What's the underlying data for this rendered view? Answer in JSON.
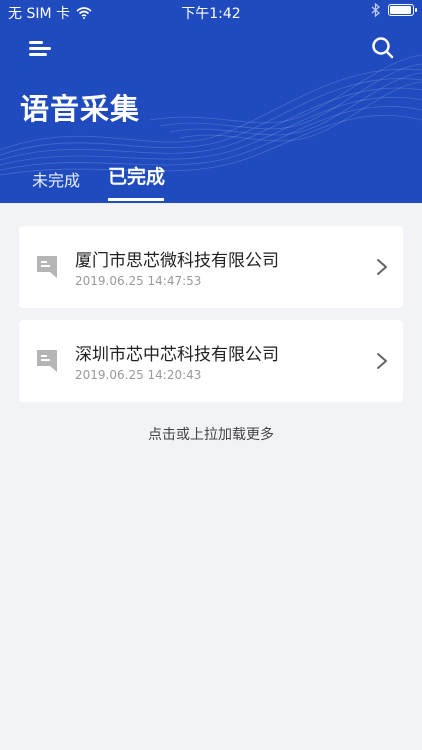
{
  "status_bar": {
    "carrier": "无 SIM 卡",
    "time": "下午1:42",
    "battery_level": 0.95
  },
  "header": {
    "title": "语音采集",
    "tabs": [
      {
        "label": "未完成",
        "active": false
      },
      {
        "label": "已完成",
        "active": true
      }
    ],
    "background_color": "#1f4bbf"
  },
  "records": [
    {
      "company": "厦门市思芯微科技有限公司",
      "datetime": "2019.06.25 14:47:53"
    },
    {
      "company": "深圳市芯中芯科技有限公司",
      "datetime": "2019.06.25 14:20:43"
    }
  ],
  "load_more": "点击或上拉加载更多",
  "icons": {
    "menu": "menu-icon",
    "search": "search-icon",
    "wifi": "wifi-icon",
    "bluetooth": "bluetooth-icon",
    "battery": "battery-icon",
    "document": "document-icon",
    "chevron": "chevron-right-icon"
  }
}
